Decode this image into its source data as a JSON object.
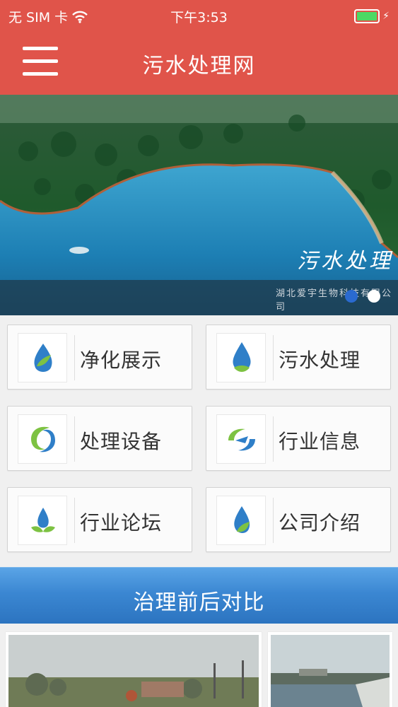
{
  "status_bar": {
    "carrier": "无 SIM 卡",
    "time": "下午3:53",
    "battery_level": 1.0
  },
  "nav": {
    "title": "污水处理网",
    "menu_icon": "hamburger-menu-icon"
  },
  "banner": {
    "caption": "污水处理",
    "subcaption": "湖北爱宇生物科技有限公司",
    "active_slide": 0,
    "slide_count": 2
  },
  "tiles": [
    {
      "label": "净化展示",
      "icon": "leaf-drop-icon"
    },
    {
      "label": "污水处理",
      "icon": "water-drop-icon"
    },
    {
      "label": "处理设备",
      "icon": "swirl-icon"
    },
    {
      "label": "行业信息",
      "icon": "swirl-arrow-icon"
    },
    {
      "label": "行业论坛",
      "icon": "drop-leaves-icon"
    },
    {
      "label": "公司介绍",
      "icon": "drop-leaf-icon"
    }
  ],
  "section": {
    "title": "治理前后对比"
  },
  "colors": {
    "header": "#e0544a",
    "section_bar": "#3b87d2",
    "tile_bg": "#fbfbfb"
  }
}
